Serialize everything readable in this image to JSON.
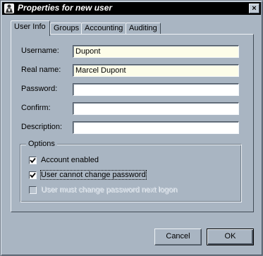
{
  "window": {
    "title": "Properties for new user",
    "close_glyph": "×"
  },
  "tabs": [
    {
      "label": "User Info",
      "active": true
    },
    {
      "label": "Groups",
      "active": false
    },
    {
      "label": "Accounting",
      "active": false
    },
    {
      "label": "Auditing",
      "active": false
    }
  ],
  "form": {
    "username": {
      "label": "Username:",
      "value": "Dupont"
    },
    "realname": {
      "label": "Real name:",
      "value": "Marcel Dupont"
    },
    "password": {
      "label": "Password:",
      "value": ""
    },
    "confirm": {
      "label": "Confirm:",
      "value": ""
    },
    "description": {
      "label": "Description:",
      "value": ""
    }
  },
  "options": {
    "legend": "Options",
    "account_enabled": {
      "label": "Account enabled",
      "checked": true
    },
    "cannot_change": {
      "label": "User cannot change password",
      "checked": true
    },
    "must_change": {
      "label": "User must change password next logon",
      "checked": false,
      "disabled": true
    }
  },
  "buttons": {
    "cancel": "Cancel",
    "ok": "OK"
  },
  "colors": {
    "window_bg": "#a9b5c2",
    "input_bg": "#fdfde9"
  },
  "icons": {
    "title_icon": "user-icon",
    "check_icon": "checkmark-icon"
  }
}
